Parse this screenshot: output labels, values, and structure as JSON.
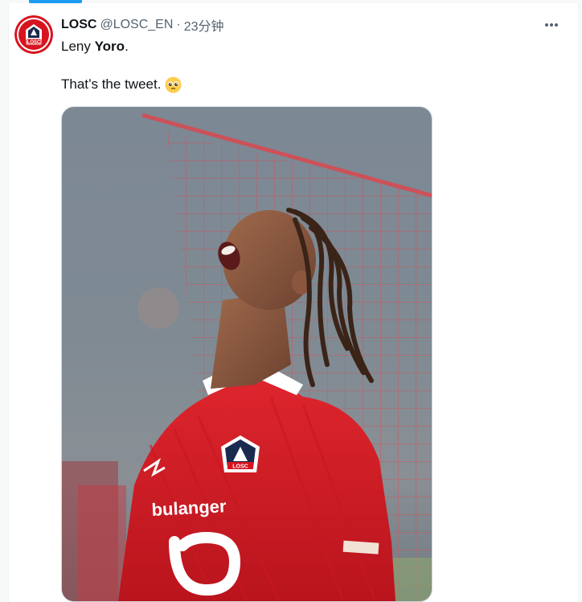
{
  "tweet": {
    "display_name": "LOSC",
    "handle": "@LOSC_EN",
    "separator": "·",
    "time": "23分钟",
    "line1_name": "Leny ",
    "line1_bold": "Yoro",
    "line1_end": ".",
    "line2": "That’s the tweet.",
    "emoji": "pleading-face-emoji",
    "avatar_text": "LOSC",
    "image": {
      "description_icon": "player-photo",
      "shirt_sponsor": "bulanger",
      "badge_text": "LOSC"
    }
  },
  "colors": {
    "accent": "#1d9bf0",
    "losc_red": "#d7141f",
    "losc_navy": "#1a2a4f"
  }
}
